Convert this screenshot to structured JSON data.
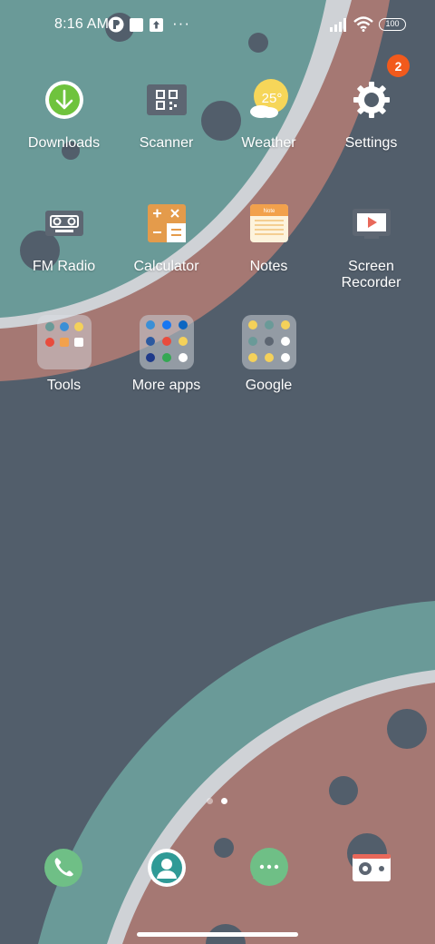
{
  "status_bar": {
    "time": "8:16 AM",
    "more": "···",
    "battery": "100"
  },
  "apps": [
    {
      "label": "Downloads"
    },
    {
      "label": "Scanner"
    },
    {
      "label": "Weather",
      "temp": "25°"
    },
    {
      "label": "Settings",
      "badge": "2"
    },
    {
      "label": "FM Radio"
    },
    {
      "label": "Calculator"
    },
    {
      "label": "Notes",
      "header": "Note"
    },
    {
      "label": "Screen Recorder"
    },
    {
      "label": "Tools"
    },
    {
      "label": "More apps"
    },
    {
      "label": "Google"
    }
  ],
  "page_indicator": {
    "pages": 2,
    "current": 2
  },
  "dock": [
    "phone-icon",
    "contacts-icon",
    "messages-icon",
    "camera-icon"
  ],
  "colors": {
    "background": "#525e6b",
    "teal": "#6a9a98",
    "rose": "#a57873",
    "light_stripe": "#cfd2d6",
    "badge": "#f25a1c"
  }
}
